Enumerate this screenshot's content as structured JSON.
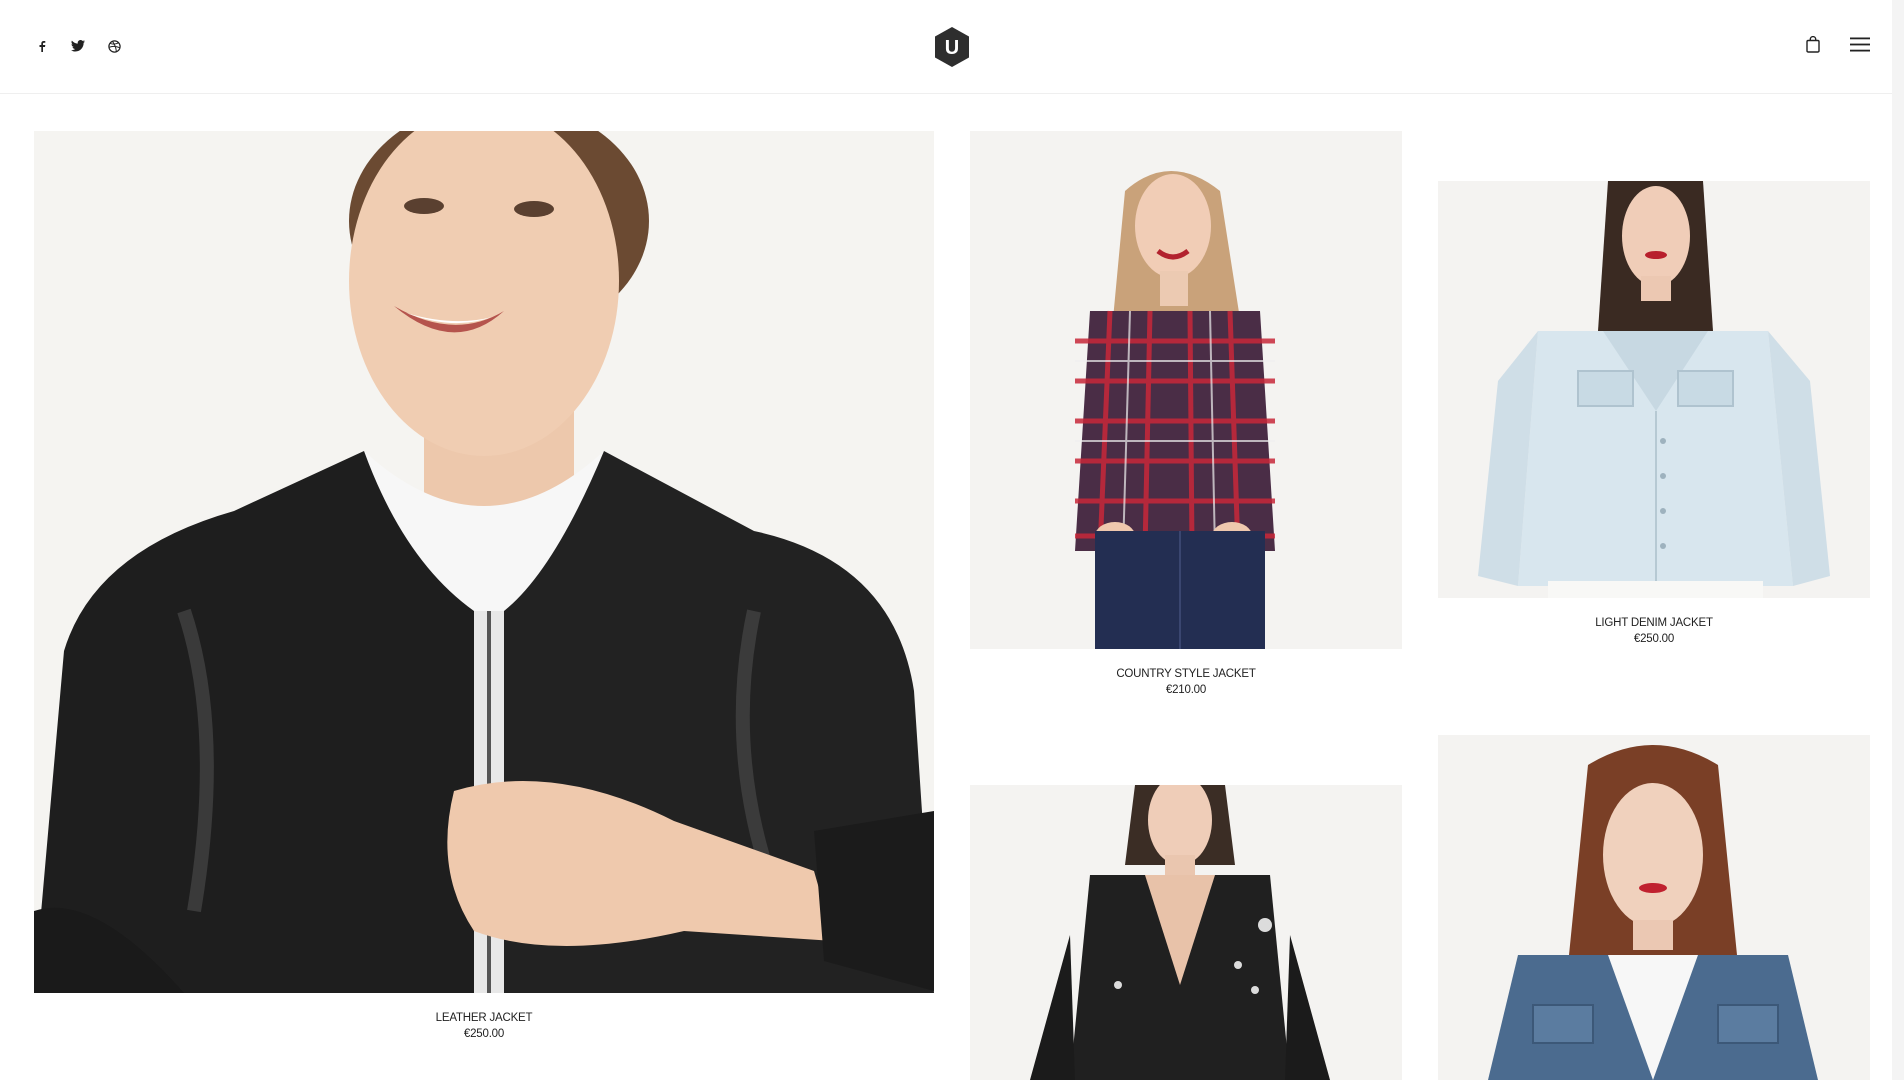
{
  "header": {
    "social": [
      "facebook-icon",
      "twitter-icon",
      "dribbble-icon"
    ],
    "logo_letter": "U",
    "actions": [
      "shopping-bag-icon",
      "menu-icon"
    ]
  },
  "products": [
    {
      "name": "LEATHER JACKET",
      "price": "€250.00"
    },
    {
      "name": "COUNTRY STYLE JACKET",
      "price": "€210.00"
    },
    {
      "name": "LIGHT DENIM JACKET",
      "price": "€250.00"
    },
    {
      "name": "",
      "price": ""
    },
    {
      "name": "",
      "price": ""
    }
  ],
  "colors": {
    "accent": "#333333",
    "background": "#ffffff",
    "photo_bg": "#f3f3f1"
  }
}
